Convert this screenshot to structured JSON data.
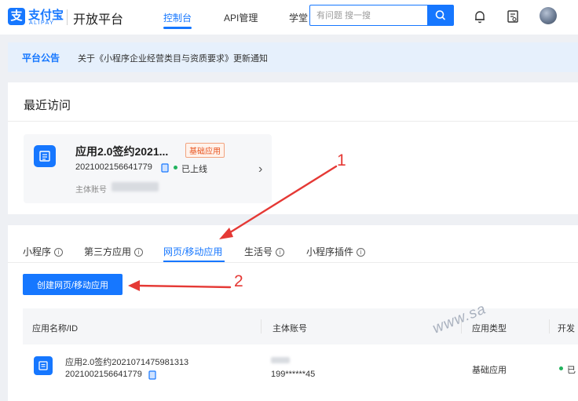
{
  "header": {
    "logo_cn": "支付宝",
    "logo_en": "ALIPAY",
    "brand": "开放平台",
    "nav": [
      "控制台",
      "API管理",
      "学堂"
    ],
    "search_placeholder": "有问题 搜一搜"
  },
  "notice": {
    "tag": "平台公告",
    "text": "关于《小程序企业经营类目与资质要求》更新通知"
  },
  "recent": {
    "title": "最近访问",
    "app": {
      "name": "应用2.0签约2021...",
      "tag": "基础应用",
      "id": "2021002156641779",
      "status": "已上线",
      "owner_label": "主体账号"
    }
  },
  "tabs": [
    {
      "label": "小程序",
      "info": "i"
    },
    {
      "label": "第三方应用",
      "info": "i"
    },
    {
      "label": "网页/移动应用"
    },
    {
      "label": "生活号",
      "info": "i"
    },
    {
      "label": "小程序插件",
      "info": "i"
    }
  ],
  "create_button": "创建网页/移动应用",
  "table": {
    "headers": [
      "应用名称/ID",
      "主体账号",
      "应用类型",
      "开发"
    ],
    "rows": [
      {
        "name": "应用2.0签约2021071475981313",
        "id": "2021002156641779",
        "owner": "199******45",
        "type": "基础应用",
        "status": "已"
      }
    ]
  },
  "annotations": [
    "1",
    "2"
  ],
  "watermark": "www.sa",
  "colors": {
    "accent": "#1677ff",
    "annotation": "#e53935",
    "tag": "#e8541f",
    "online": "#22b35e"
  }
}
